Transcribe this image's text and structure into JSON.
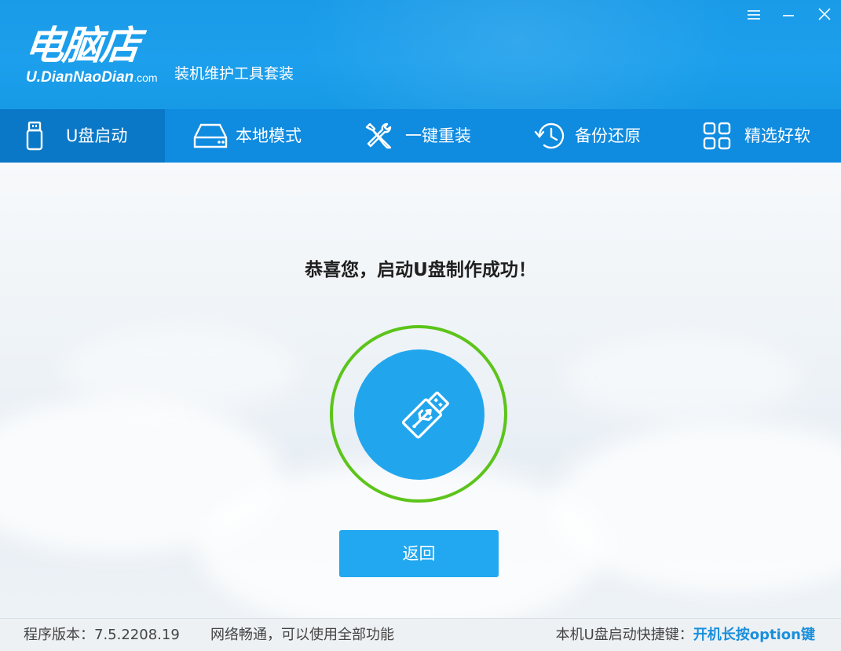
{
  "app": {
    "logo_main": "电脑店",
    "logo_sub": "U.DianNaoDian",
    "logo_domain": ".com",
    "slogan": "装机维护工具套装",
    "window_controls": [
      "menu-icon",
      "minimize-icon",
      "close-icon"
    ]
  },
  "tabs": [
    {
      "label": "U盘启动",
      "icon": "usb-drive-icon",
      "active": true
    },
    {
      "label": "本地模式",
      "icon": "hard-drive-icon",
      "active": false
    },
    {
      "label": "一键重装",
      "icon": "tools-icon",
      "active": false
    },
    {
      "label": "备份还原",
      "icon": "restore-icon",
      "active": false
    },
    {
      "label": "精选好软",
      "icon": "apps-grid-icon",
      "active": false
    }
  ],
  "main": {
    "title": "恭喜您，启动U盘制作成功！",
    "status_icon": "usb-success-icon",
    "back_label": "返回"
  },
  "footer": {
    "version": "程序版本：7.5.2208.19",
    "network": "网络畅通，可以使用全部功能",
    "hotkey_label": "本机U盘启动快捷键：",
    "hotkey_value": "开机长按option键"
  },
  "colors": {
    "header": "#1c9fec",
    "tabbar": "#0f8be0",
    "tab_active": "#0b78c7",
    "accent": "#22a8f0",
    "ring": "#5cc41a",
    "hotkey": "#1a8fdc"
  }
}
